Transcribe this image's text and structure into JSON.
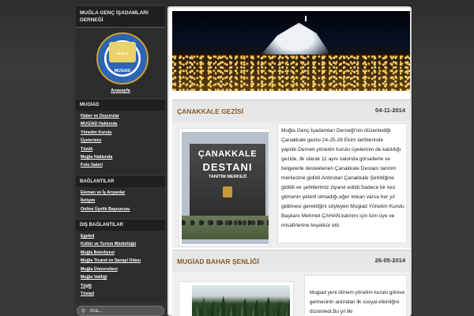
{
  "sidebar": {
    "title": "MUĞLA GENÇ İŞADAMLARI DERNEĞİ",
    "logo": {
      "name_text": "MUĞLA",
      "brand": "MUGIAD"
    },
    "home_link": "Anasayfa",
    "sections": [
      {
        "heading": "MUGİAD",
        "items": [
          "Haber ve Duyurular",
          "MUGİAD Hakkında",
          "Yönetim Kurulu",
          "Üyelerimiz",
          "Tüzük",
          "Muğla Hakkında",
          "Foto Galeri"
        ]
      },
      {
        "heading": "BAĞLANTILAR",
        "items": [
          "Eleman ve İş Arıyanlar",
          "İletişim",
          "Online Üyelik Başvurusu"
        ]
      },
      {
        "heading": "DIŞ BAĞLANTILAR",
        "items": [
          "Egeled",
          "Kültür ve Turizm Müdürlüğü",
          "Muğla Belediyesi",
          "Muğla Ticaret ve Sanayi Odası",
          "Muğla Üniversitesi",
          "Muğla Valiliği",
          "Tügik",
          "Tüsiad"
        ]
      }
    ],
    "search": {
      "placeholder": "Ara...",
      "icon": "search-icon"
    }
  },
  "posts": [
    {
      "title": "ÇANAKKALE GEZİSİ",
      "date": "04-11-2014",
      "photo_sign": {
        "line1": "ÇANAKKALE",
        "line2": "DESTANI",
        "line3": "TANITIM MERKEZİ"
      },
      "text": "Muğla Genç İşadamları Derneği'nin düzenlediği Çanakkale gezisi 24-25-26 Ekim tarihlerinde yapıldı.Dernek yönetim kurulu üyelerinin de katıldığı gezide, ilk olarak 11 aynı salonda görsellerle ve belgelerle desteklenen Çanakkale Destanı tanıtım merkezine gidildi.Ardından Çanakkale Şehitliğine gidildi ve şehitlerimiz ziyaret edildi.Sadece bir kez gitmenin yeterli olmadığı,eğer imkan varsa her yıl gidilmesi gerektiğini söyleyen Mugiad Yönetim Kurulu Başkanı Mehmet ÇAHAN,katılımı için tüm üye ve misafirlerine teşekkür etti."
    },
    {
      "title": "MUGİAD BAHAR ŞENLİĞİ",
      "date": "26-05-2014",
      "text": "Mugiad yeni dönem yönetim kurulu göreve gelmesinin ardından ilk sosyal etkinliğini düzenledi.Bu yıl ilki"
    }
  ]
}
